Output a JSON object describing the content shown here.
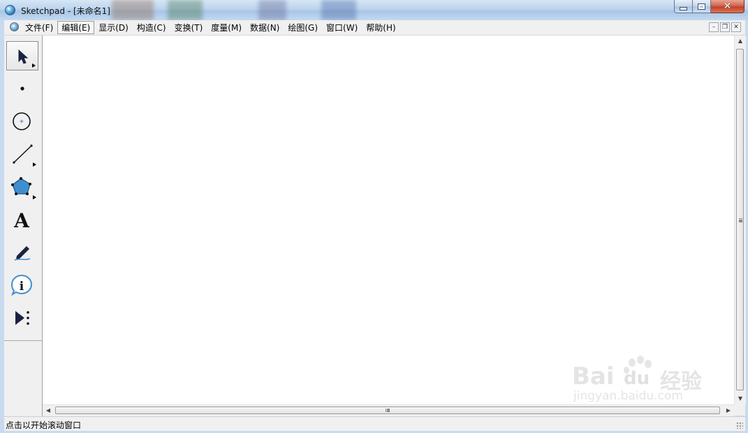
{
  "window": {
    "title": "Sketchpad  - [未命名1]"
  },
  "menubar": {
    "items": [
      {
        "label": "文件(F)"
      },
      {
        "label": "编辑(E)"
      },
      {
        "label": "显示(D)"
      },
      {
        "label": "构造(C)"
      },
      {
        "label": "变换(T)"
      },
      {
        "label": "度量(M)"
      },
      {
        "label": "数据(N)"
      },
      {
        "label": "绘图(G)"
      },
      {
        "label": "窗口(W)"
      },
      {
        "label": "帮助(H)"
      }
    ],
    "active_item": "编辑(E)"
  },
  "toolbox": {
    "tools": [
      {
        "icon": "arrow-select-icon",
        "selected": true
      },
      {
        "icon": "point-icon",
        "selected": false
      },
      {
        "icon": "compass-circle-icon",
        "selected": false
      },
      {
        "icon": "straightedge-icon",
        "selected": false
      },
      {
        "icon": "polygon-icon",
        "selected": false
      },
      {
        "icon": "text-icon",
        "selected": false
      },
      {
        "icon": "marker-icon",
        "selected": false
      },
      {
        "icon": "information-icon",
        "selected": false
      },
      {
        "icon": "custom-tool-icon",
        "selected": false
      }
    ]
  },
  "watermark": {
    "brand": "Bai",
    "brand2": "du",
    "product": "经验",
    "url": "jingyan.baidu.com"
  },
  "statusbar": {
    "text": "点击以开始滚动窗口"
  },
  "colors": {
    "titlebar": "#bcd4ee",
    "close_button": "#c04228",
    "canvas": "#ffffff",
    "chrome": "#f0f0f0",
    "polygon_fill": "#3f8fd0"
  }
}
